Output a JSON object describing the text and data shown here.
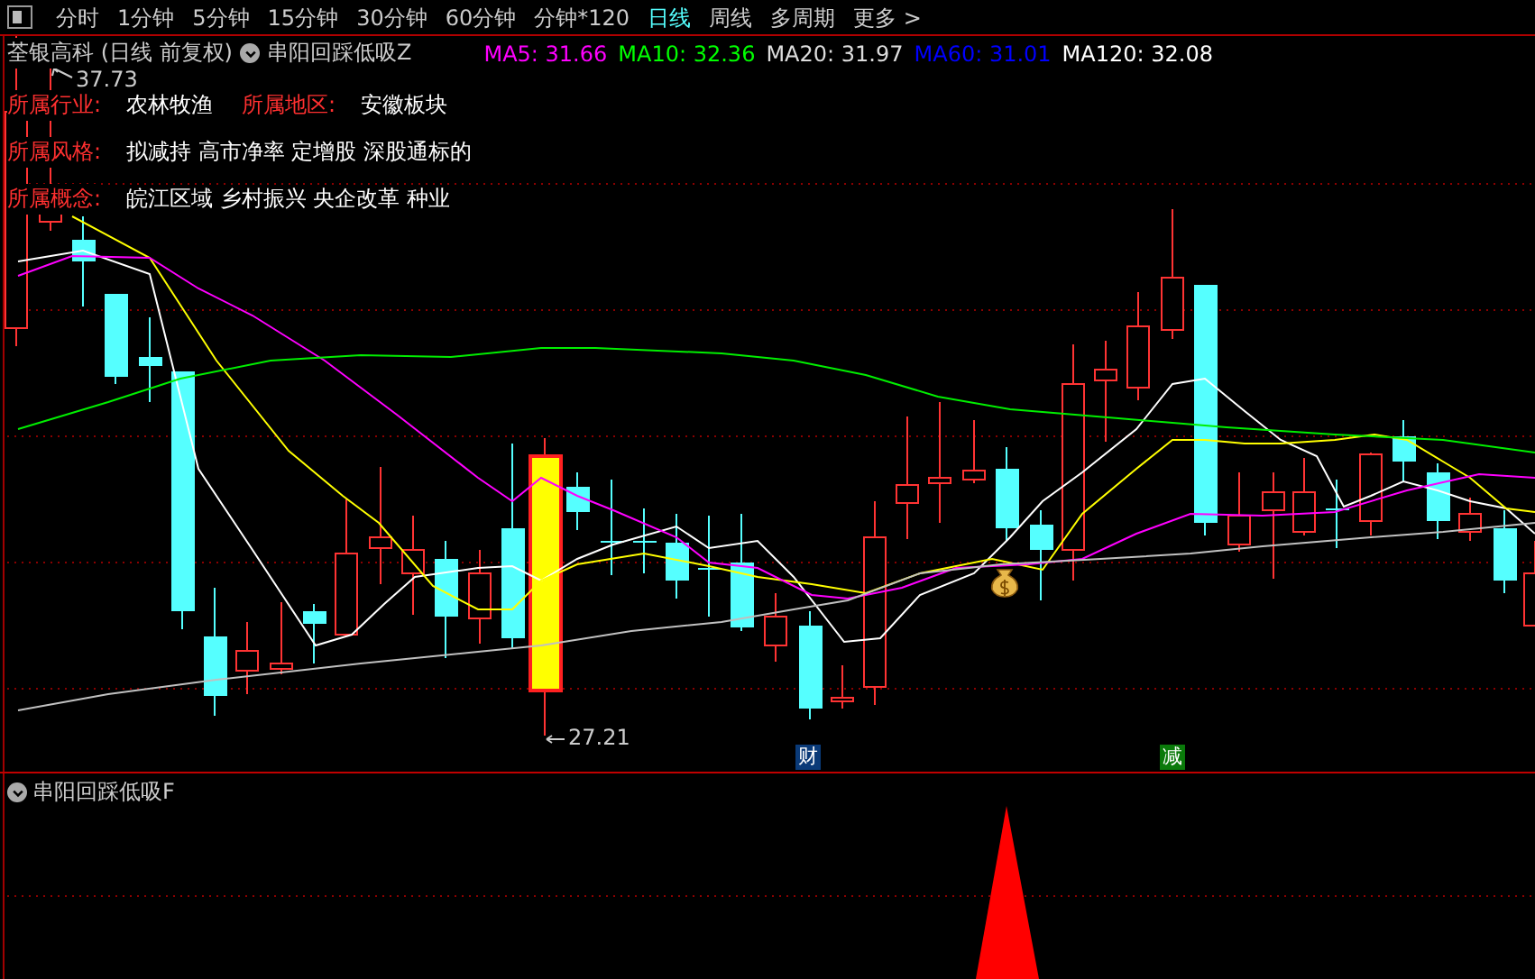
{
  "toolbar": {
    "tabs": [
      {
        "label": "分时",
        "selected": false
      },
      {
        "label": "1分钟",
        "selected": false
      },
      {
        "label": "5分钟",
        "selected": false
      },
      {
        "label": "15分钟",
        "selected": false
      },
      {
        "label": "30分钟",
        "selected": false
      },
      {
        "label": "60分钟",
        "selected": false
      },
      {
        "label": "分钟*120",
        "selected": false
      },
      {
        "label": "日线",
        "selected": true
      },
      {
        "label": "周线",
        "selected": false
      },
      {
        "label": "多周期",
        "selected": false
      },
      {
        "label": "更多 >",
        "selected": false
      }
    ]
  },
  "chart_header": {
    "title": "荃银高科 (日线 前复权)",
    "indicator": "串阳回踩低吸Z",
    "ma_readings": [
      {
        "text": "MA5: 31.66",
        "color": "#ff00ff"
      },
      {
        "text": "MA10: 32.36",
        "color": "#00ff00"
      },
      {
        "text": "MA20: 31.97",
        "color": "#dddddd"
      },
      {
        "text": "MA60: 31.01",
        "color": "#0000ff"
      },
      {
        "text": "MA120: 32.08",
        "color": "#ffffff"
      }
    ]
  },
  "info_rows": [
    {
      "fields": [
        {
          "label": "所属行业:",
          "value": "农林牧渔"
        },
        {
          "label": "所属地区:",
          "value": "安徽板块"
        }
      ]
    },
    {
      "fields": [
        {
          "label": "所属风格:",
          "value": "拟减持 高市净率 定增股 深股通标的"
        }
      ]
    },
    {
      "fields": [
        {
          "label": "所属概念:",
          "value": "皖江区域 乡村振兴 央企改革 种业"
        }
      ]
    }
  ],
  "price_labels": {
    "high": "37.73",
    "low": "27.21"
  },
  "event_markers": [
    {
      "text": "财",
      "color": "#0a3a78"
    },
    {
      "text": "减",
      "color": "#0a7a0a"
    }
  ],
  "lower_panel": {
    "title": "串阳回踩低吸F"
  }
}
